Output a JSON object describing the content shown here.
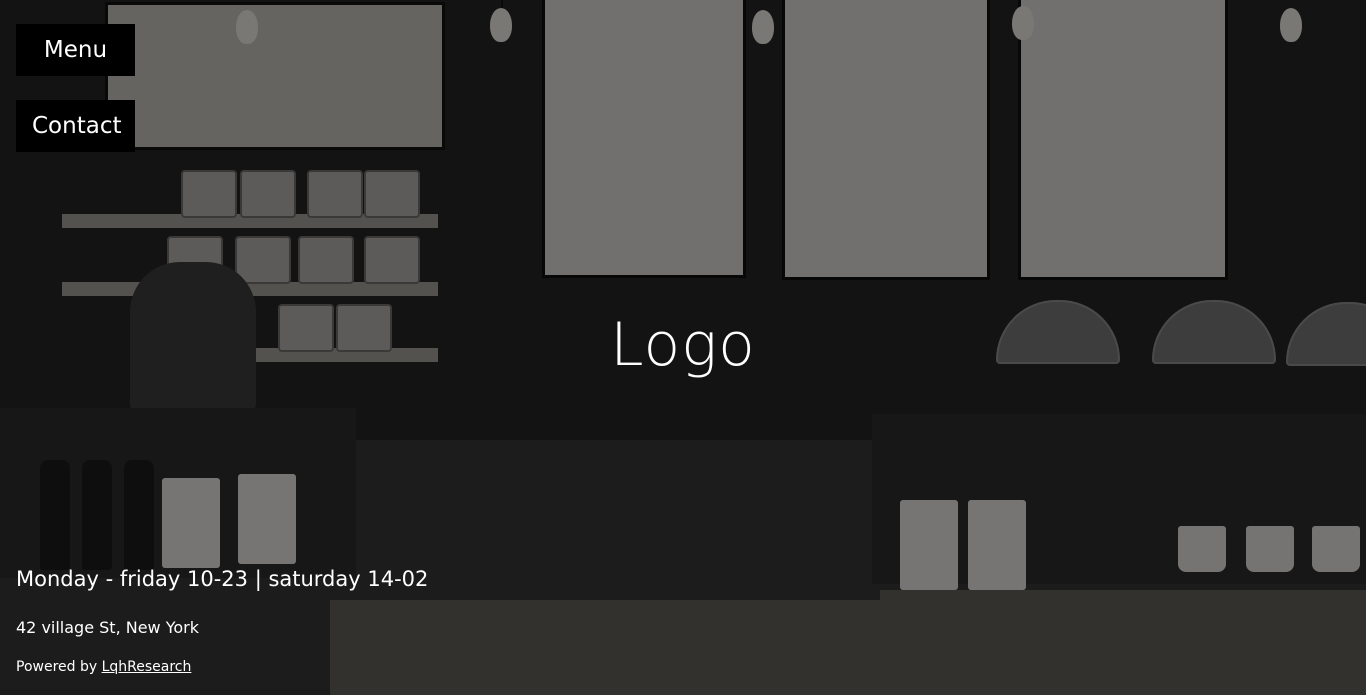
{
  "nav": {
    "menu_label": "Menu",
    "contact_label": "Contact"
  },
  "hero": {
    "logo_text": "Logo",
    "background": "cafe-counter-photo"
  },
  "info": {
    "hours": "Monday - friday 10-23 | saturday 14-02",
    "address": "42 village St, New York",
    "powered_prefix": "Powered by ",
    "powered_link": "LqhResearch"
  },
  "colors": {
    "button_bg": "#000000",
    "text": "#ffffff"
  }
}
